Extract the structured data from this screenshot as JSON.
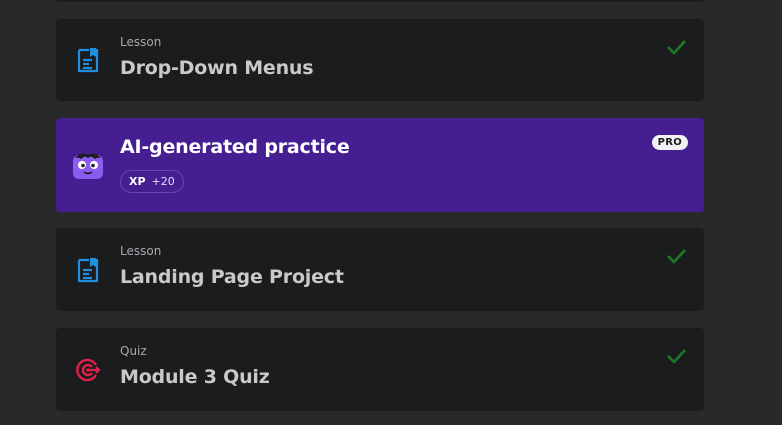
{
  "items": [
    {
      "type": "Lesson",
      "title": "Drop-Down Menus",
      "icon": "lesson-document-icon",
      "completed": true
    },
    {
      "title": "AI-generated practice",
      "icon": "ai-mascot-icon",
      "badge": "PRO",
      "xp_label": "XP",
      "xp_value": "+20"
    },
    {
      "type": "Lesson",
      "title": "Landing Page Project",
      "icon": "lesson-document-icon",
      "completed": true
    },
    {
      "type": "Quiz",
      "title": "Module 3 Quiz",
      "icon": "quiz-target-icon",
      "completed": true
    }
  ],
  "colors": {
    "background": "#28292b",
    "card": "#1b1c1e",
    "pro_card": "#451e92",
    "lesson_icon": "#1f8fe0",
    "quiz_icon": "#e0204a",
    "check": "#1e7a22"
  }
}
